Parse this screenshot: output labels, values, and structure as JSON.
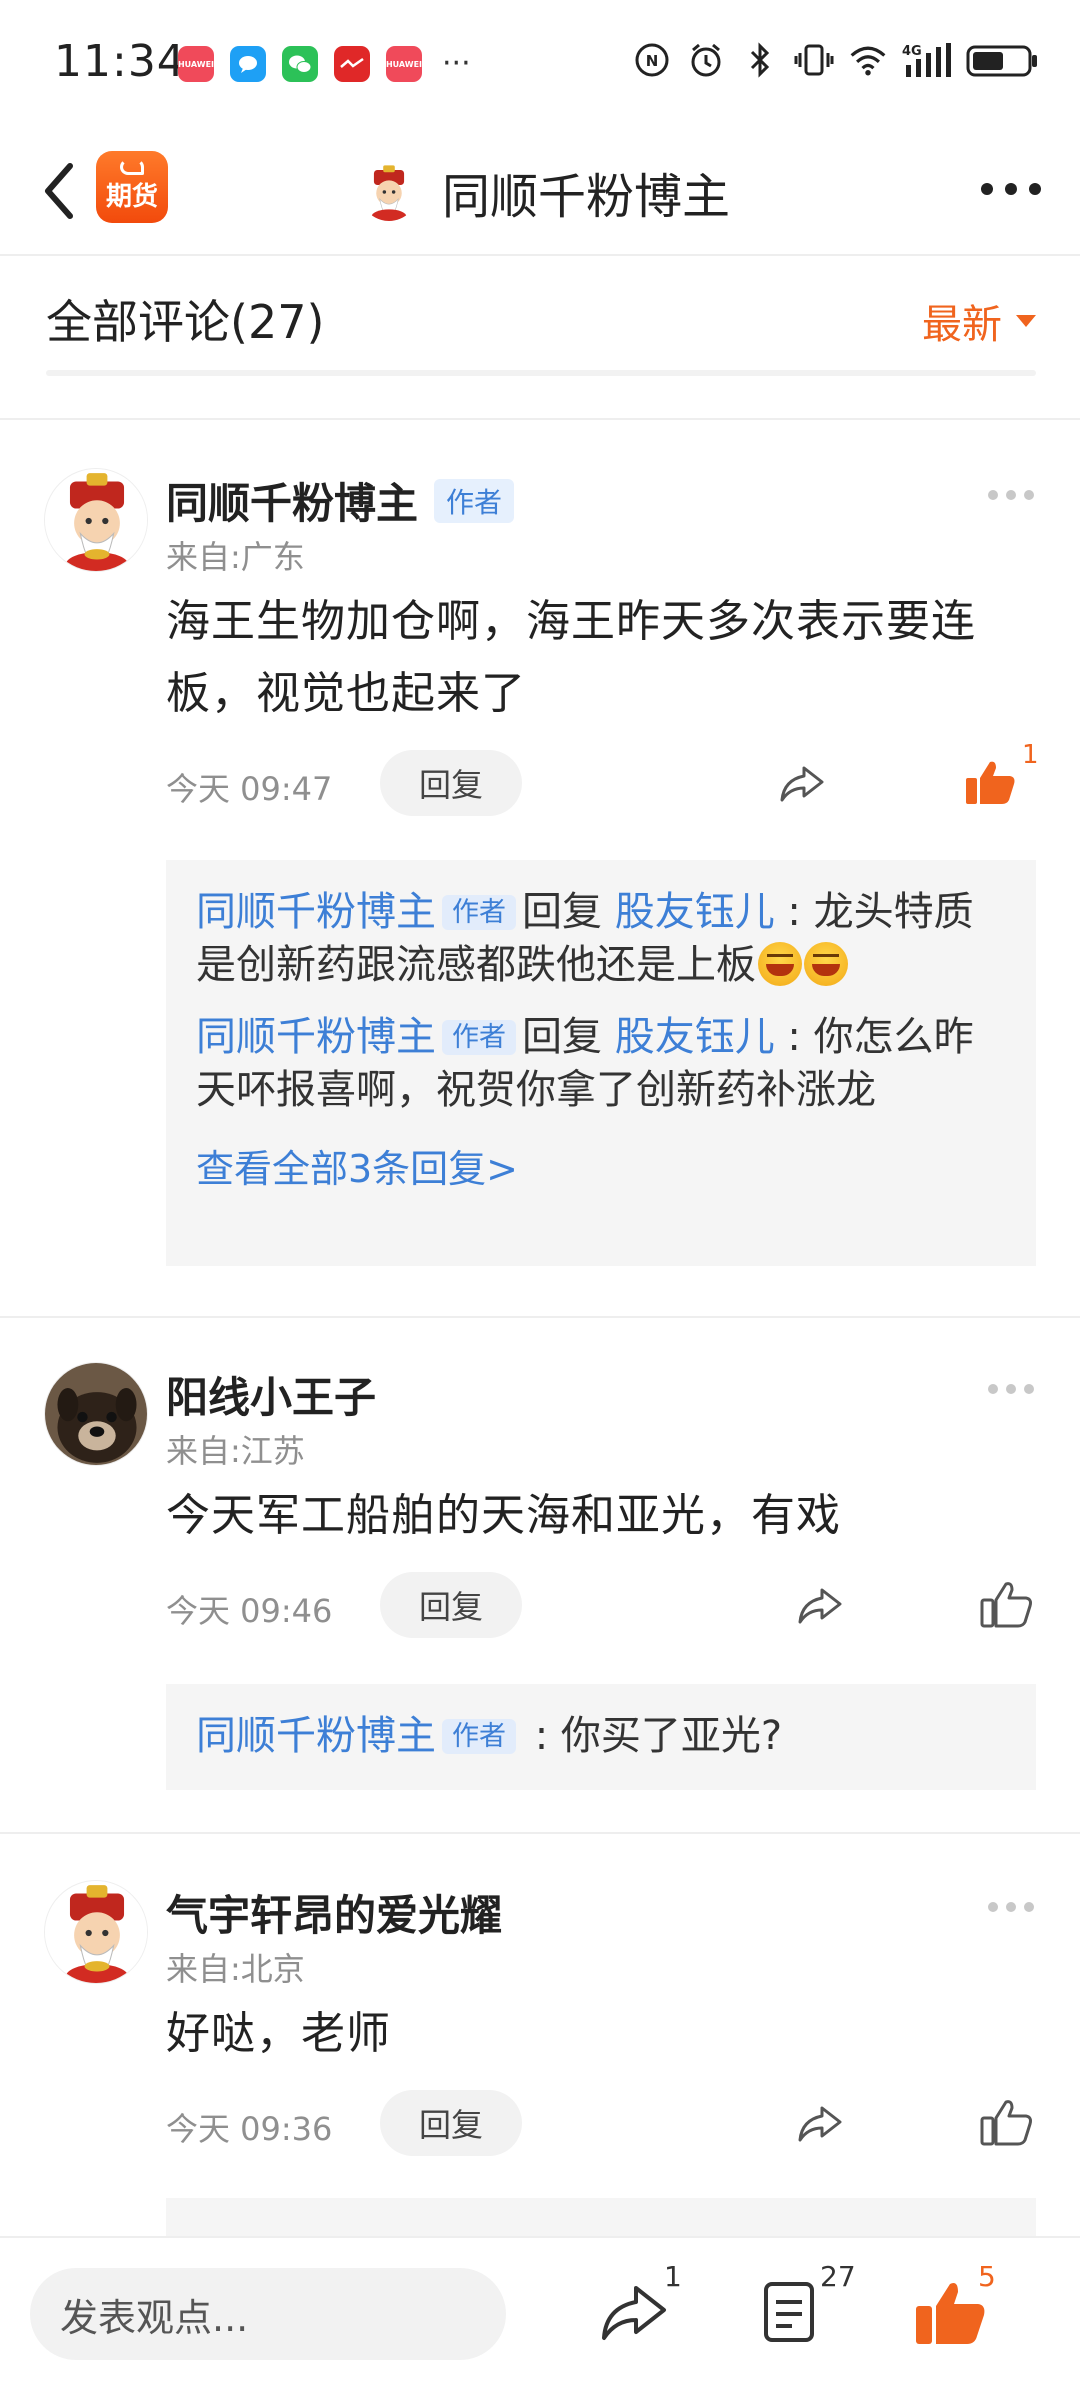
{
  "status_bar": {
    "time": "11:34",
    "notification_apps": [
      "huawei-store",
      "messages",
      "wechat",
      "news-app",
      "huawei-appgallery"
    ],
    "more_dots": "···",
    "indicators": [
      "nfc",
      "alarm",
      "bluetooth",
      "vibrate",
      "wifi",
      "4g-signal",
      "battery"
    ],
    "network_label": "4G"
  },
  "header": {
    "back_icon": "chevron-left-icon",
    "app_badge": "期货",
    "title": "同顺千粉博主",
    "more_icon": "more-horizontal-icon"
  },
  "comments_header": {
    "title": "全部评论(27)",
    "sort_label": "最新"
  },
  "comments": [
    {
      "name": "同顺千粉博主",
      "is_author": true,
      "author_tag": "作者",
      "from": "来自:广东",
      "text": "海王生物加仓啊，海王昨天多次表示要连板，视觉也起来了",
      "time": "今天 09:47",
      "reply_label": "回复",
      "likes": "1",
      "liked": true,
      "replies": [
        {
          "user": "同顺千粉博主",
          "tag": "作者",
          "action": "回复",
          "target": "股友钰儿",
          "text": "龙头特质是创新药跟流感都跌他还是上板"
        },
        {
          "user": "同顺千粉博主",
          "tag": "作者",
          "action": "回复",
          "target": "股友钰儿",
          "text": "你怎么昨天吥报喜啊，祝贺你拿了创新药补涨龙"
        }
      ],
      "view_all": "查看全部3条回复>"
    },
    {
      "name": "阳线小王子",
      "is_author": false,
      "from": "来自:江苏",
      "text": "今天军工船舶的天海和亚光，有戏",
      "time": "今天 09:46",
      "reply_label": "回复",
      "liked": false,
      "replies": [
        {
          "user": "同顺千粉博主",
          "tag": "作者",
          "text": "你买了亚光?"
        }
      ]
    },
    {
      "name": "气宇轩昂的爱光耀",
      "is_author": false,
      "from": "来自:北京",
      "text": "好哒，老师",
      "time": "今天 09:36",
      "reply_label": "回复",
      "liked": false
    }
  ],
  "bottom_bar": {
    "input_placeholder": "发表观点...",
    "share_count": "1",
    "comment_count": "27",
    "like_count": "5"
  },
  "colors": {
    "accent_orange": "#f0641e",
    "link_blue": "#3d7fd6",
    "muted_gray": "#8f8f8f"
  }
}
